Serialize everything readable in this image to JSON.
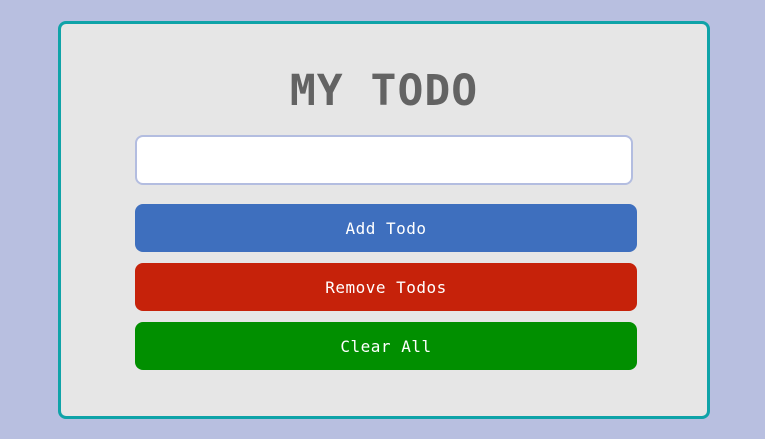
{
  "app": {
    "title": "MY TODO"
  },
  "input": {
    "value": "",
    "placeholder": ""
  },
  "buttons": {
    "add_label": "Add Todo",
    "remove_label": "Remove Todos",
    "clear_label": "Clear All"
  },
  "colors": {
    "background": "#b8bfe0",
    "card": "#e6e6e6",
    "card_border": "#0fa3a8",
    "add": "#3e6fbe",
    "remove": "#c6220a",
    "clear": "#018f00",
    "title_text": "#636363"
  }
}
